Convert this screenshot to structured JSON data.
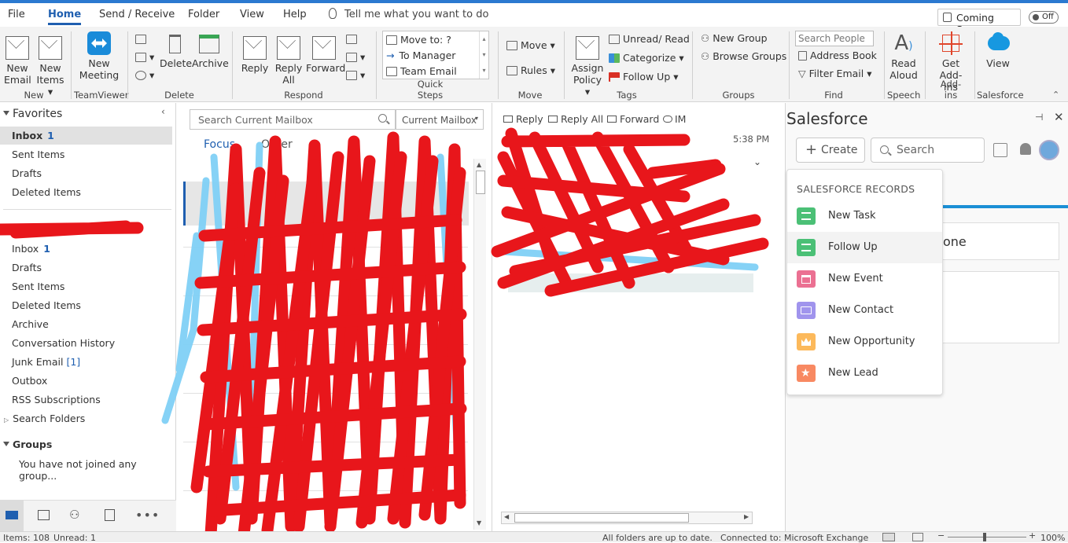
{
  "menu": {
    "tabs": [
      "File",
      "Home",
      "Send / Receive",
      "Folder",
      "View",
      "Help"
    ],
    "tell_me": "Tell me what you want to do",
    "coming_soon": "Coming Soon",
    "toggle": "Off"
  },
  "ribbon": {
    "new_email": [
      "New",
      "Email"
    ],
    "new_items": [
      "New",
      "Items ▾"
    ],
    "new_group": "New",
    "new_meeting": [
      "New",
      "Meeting"
    ],
    "teamviewer_group": "TeamViewer",
    "delete": "Delete",
    "archive": "Archive",
    "delete_group": "Delete",
    "reply": "Reply",
    "reply_all": [
      "Reply",
      "All"
    ],
    "forward": "Forward",
    "respond_group": "Respond",
    "quick_steps": [
      "Move to: ?",
      "To Manager",
      "Team Email"
    ],
    "quick_steps_group": "Quick Steps",
    "move": "Move ▾",
    "rules": "Rules ▾",
    "move_group": "Move",
    "assign_policy": [
      "Assign",
      "Policy ▾"
    ],
    "unread_read": "Unread/ Read",
    "categorize": "Categorize ▾",
    "follow_up": "Follow Up ▾",
    "tags_group": "Tags",
    "new_group_btn": "New Group",
    "browse_groups": "Browse Groups",
    "groups_group": "Groups",
    "search_people": "Search People",
    "address_book": "Address Book",
    "filter_email": "Filter Email ▾",
    "find_group": "Find",
    "read_aloud": [
      "Read",
      "Aloud"
    ],
    "speech_group": "Speech",
    "get_addins": [
      "Get",
      "Add-ins"
    ],
    "addins_group": "Add-ins",
    "view": "View",
    "salesforce_group": "Salesforce"
  },
  "nav": {
    "favorites": "Favorites",
    "fav_items": [
      {
        "label": "Inbox",
        "count": "1"
      },
      {
        "label": "Sent Items"
      },
      {
        "label": "Drafts"
      },
      {
        "label": "Deleted Items"
      }
    ],
    "inbox": "Inbox",
    "inbox_count": "1",
    "drafts": "Drafts",
    "sent": "Sent Items",
    "deleted": "Deleted Items",
    "archive": "Archive",
    "conv_history": "Conversation History",
    "junk": "Junk Email",
    "junk_count": "[1]",
    "outbox": "Outbox",
    "rss": "RSS Subscriptions",
    "search_folders": "Search Folders",
    "groups": "Groups",
    "groups_msg": "You have not joined any group..."
  },
  "list": {
    "search_placeholder": "Search Current Mailbox",
    "scope": "Current Mailbox",
    "focused": "Focus",
    "other": "Other"
  },
  "reading": {
    "reply": "Reply",
    "reply_all": "Reply All",
    "forward": "Forward",
    "im": "IM",
    "time": "5:38 PM"
  },
  "salesforce": {
    "title": "Salesforce",
    "create": "Create",
    "search": "Search",
    "records_header": "SALESFORCE RECORDS",
    "items": [
      "New Task",
      "Follow Up",
      "New Event",
      "New Contact",
      "New Opportunity",
      "New Lead"
    ],
    "card_text": "one"
  },
  "status": {
    "items": "Items: 108",
    "unread": "Unread: 1",
    "uptodate": "All folders are up to date.",
    "connected": "Connected to: Microsoft Exchange",
    "zoom": "100%"
  },
  "colors": {
    "accent": "#1f5fb0",
    "salesforce_blue": "#1b8fd5",
    "scribble_red": "#e8161b",
    "scribble_blue": "#7fd0f5",
    "task_green": "#4bc076",
    "event_pink": "#eb7092",
    "contact_purple": "#a094ed",
    "opportunity_yellow": "#fcb95b",
    "lead_orange": "#f88962"
  }
}
